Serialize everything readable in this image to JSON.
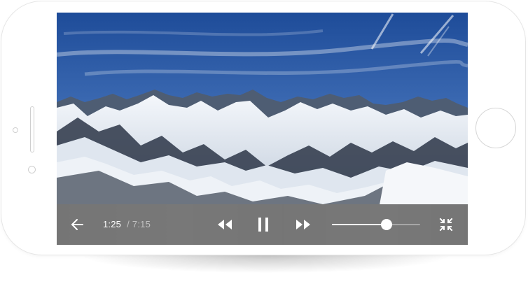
{
  "player": {
    "current_time": "1:25",
    "separator": "/",
    "total_time": "7:15",
    "volume_level": 0.62
  },
  "icons": {
    "back": "arrow-left-icon",
    "rewind": "rewind-icon",
    "pause": "pause-icon",
    "fast_forward": "fast-forward-icon",
    "fullscreen": "collapse-fullscreen-icon"
  },
  "colors": {
    "controls_bar": "#767676",
    "controls_foreground": "#ffffff",
    "sky_top": "#1f4f9c",
    "sky_bottom": "#8fb2d9"
  }
}
